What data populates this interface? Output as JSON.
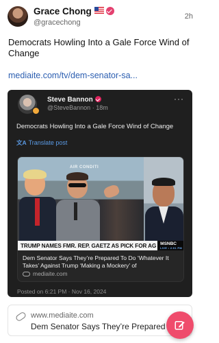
{
  "author": {
    "name": "Grace Chong",
    "handle": "@gracechong",
    "flag_icon": "us-flag-icon",
    "verified_icon": "verified-badge-icon",
    "time": "2h"
  },
  "post": {
    "text": "Democrats Howling Into a Gale Force Wind of Change",
    "link_text": "mediaite.com/tv/dem-senator-sa..."
  },
  "embed": {
    "author_name": "Steve Bannon",
    "author_handle": "@SteveBannon",
    "separator": "·",
    "time": "18m",
    "more_label": "···",
    "text": "Democrats Howling Into a Gale Force Wind of Change",
    "translate_label": "Translate post",
    "article": {
      "image_sign": "AIR CONDITI",
      "chyron": "TRUMP NAMES FMR. REP. GAETZ AS PICK FOR AG",
      "network": "MSNBC",
      "network_sub": "LIVE • 2:01 PM",
      "title": "Dem Senator Says They’re Prepared To Do ‘Whatever It Takes’ Against Trump ‘Making a Mockery’ of",
      "domain": "mediaite.com"
    },
    "posted_on": "Posted on 6:21 PM · Nov 16, 2024"
  },
  "link_preview": {
    "domain": "www.mediaite.com",
    "title": "Dem Senator Says They’re Prepared To Do"
  },
  "colors": {
    "accent": "#ef4c6c",
    "link": "#2a5db0",
    "embed_bg": "#1f1f1f"
  }
}
